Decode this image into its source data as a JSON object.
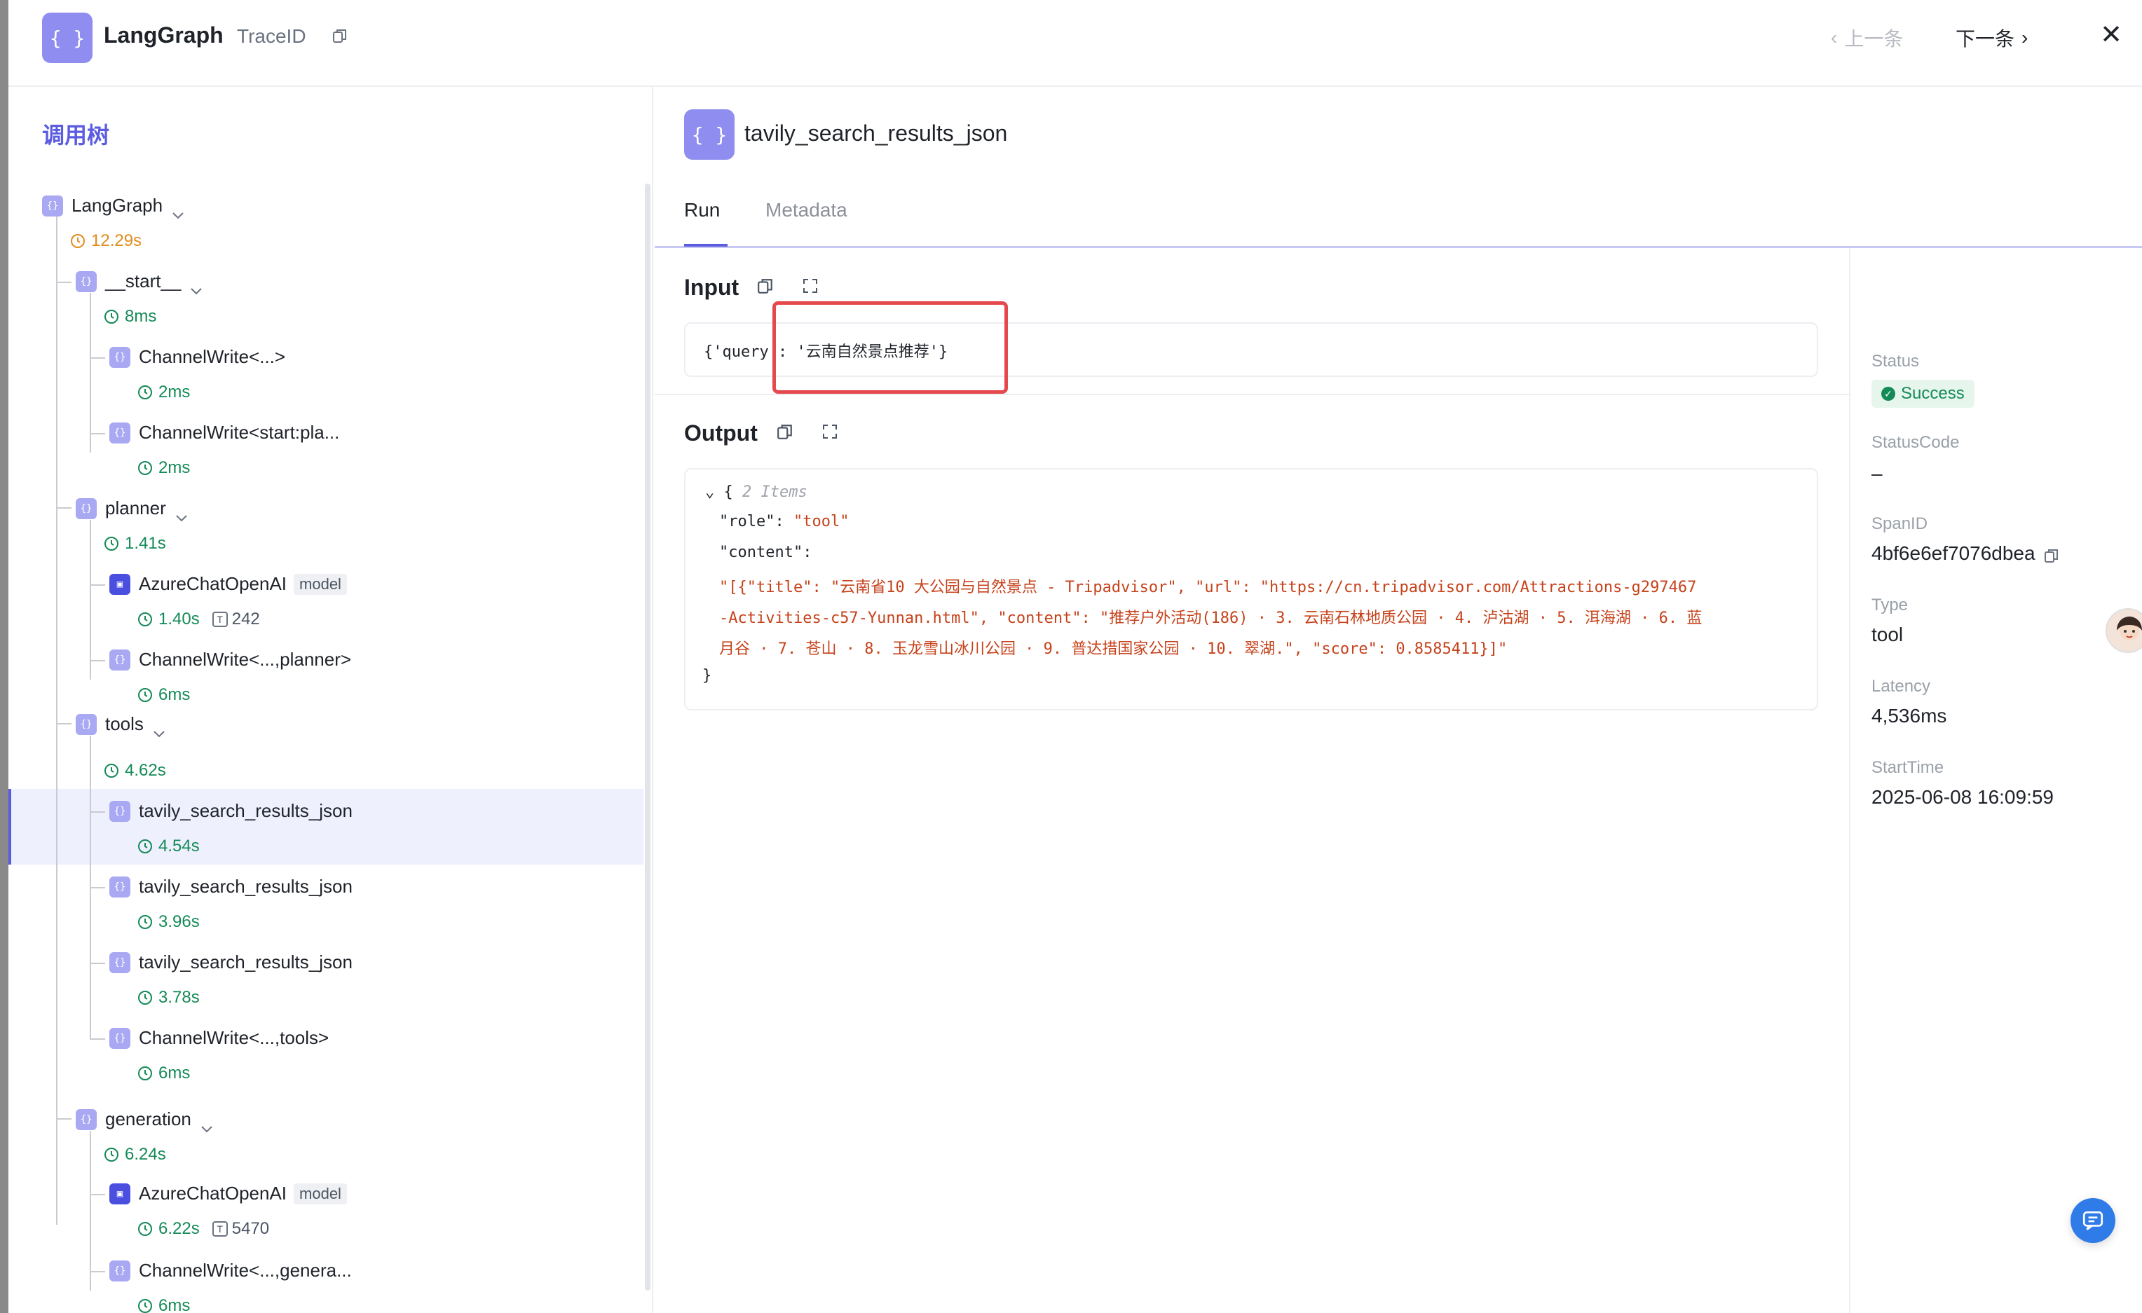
{
  "header": {
    "logo_glyph": "{ }",
    "title": "LangGraph",
    "trace_label": "TraceID",
    "prev_label": "上一条",
    "next_label": "下一条"
  },
  "left_panel": {
    "title": "调用树",
    "nodes": {
      "n0": {
        "label": "LangGraph",
        "duration": "12.29s"
      },
      "n1": {
        "label": "__start__",
        "duration": "8ms"
      },
      "n2": {
        "label": "ChannelWrite<...>",
        "duration": "2ms"
      },
      "n3": {
        "label": "ChannelWrite<start:pla...",
        "duration": "2ms"
      },
      "n4": {
        "label": "planner",
        "duration": "1.41s"
      },
      "n5": {
        "label": "AzureChatOpenAI",
        "tag": "model",
        "duration": "1.40s",
        "tokens": "242"
      },
      "n6": {
        "label": "ChannelWrite<...,planner>",
        "duration": "6ms"
      },
      "n7": {
        "label": "tools",
        "duration": "4.62s"
      },
      "n8": {
        "label": "tavily_search_results_json",
        "duration": "4.54s"
      },
      "n9": {
        "label": "tavily_search_results_json",
        "duration": "3.96s"
      },
      "n10": {
        "label": "tavily_search_results_json",
        "duration": "3.78s"
      },
      "n11": {
        "label": "ChannelWrite<...,tools>",
        "duration": "6ms"
      },
      "n12": {
        "label": "generation",
        "duration": "6.24s"
      },
      "n13": {
        "label": "AzureChatOpenAI",
        "tag": "model",
        "duration": "6.22s",
        "tokens": "5470"
      },
      "n14": {
        "label": "ChannelWrite<...,genera...",
        "duration": "6ms"
      }
    }
  },
  "detail": {
    "span_title": "tavily_search_results_json",
    "tabs": {
      "run": "Run",
      "metadata": "Metadata"
    },
    "input_title": "Input",
    "input_value": "{'query': '云南自然景点推荐'}",
    "output_title": "Output",
    "output": {
      "open": "{",
      "items_hint": "2 Items",
      "role_key": "\"role\":",
      "role_value": "\"tool\"",
      "content_key": "\"content\":",
      "content_line1": "\"[{\"title\": \"云南省10 大公园与自然景点 - Tripadvisor\", \"url\": \"https://cn.tripadvisor.com/Attractions-g297467",
      "content_line2": "-Activities-c57-Yunnan.html\", \"content\": \"推荐户外活动(186) · 3. 云南石林地质公园 · 4. 泸沽湖 · 5. 洱海湖 · 6. 蓝",
      "content_line3": "月谷 · 7. 苍山 · 8. 玉龙雪山冰川公园 · 9. 普达措国家公园 · 10. 翠湖.\", \"score\": 0.8585411}]\"",
      "close": "}"
    }
  },
  "meta": {
    "status_label": "Status",
    "status_value": "Success",
    "status_code_label": "StatusCode",
    "status_code_value": "–",
    "span_id_label": "SpanID",
    "span_id_value": "4bf6e6ef7076dbea",
    "type_label": "Type",
    "type_value": "tool",
    "latency_label": "Latency",
    "latency_value": "4,536ms",
    "start_time_label": "StartTime",
    "start_time_value": "2025-06-08 16:09:59"
  },
  "colors": {
    "accent": "#5b5ce0",
    "node_icon": "#a9a8f2",
    "duration_green": "#148a57",
    "duration_orange": "#e08b1e",
    "json_string": "#c6421b",
    "highlight_red": "#e5484d"
  }
}
